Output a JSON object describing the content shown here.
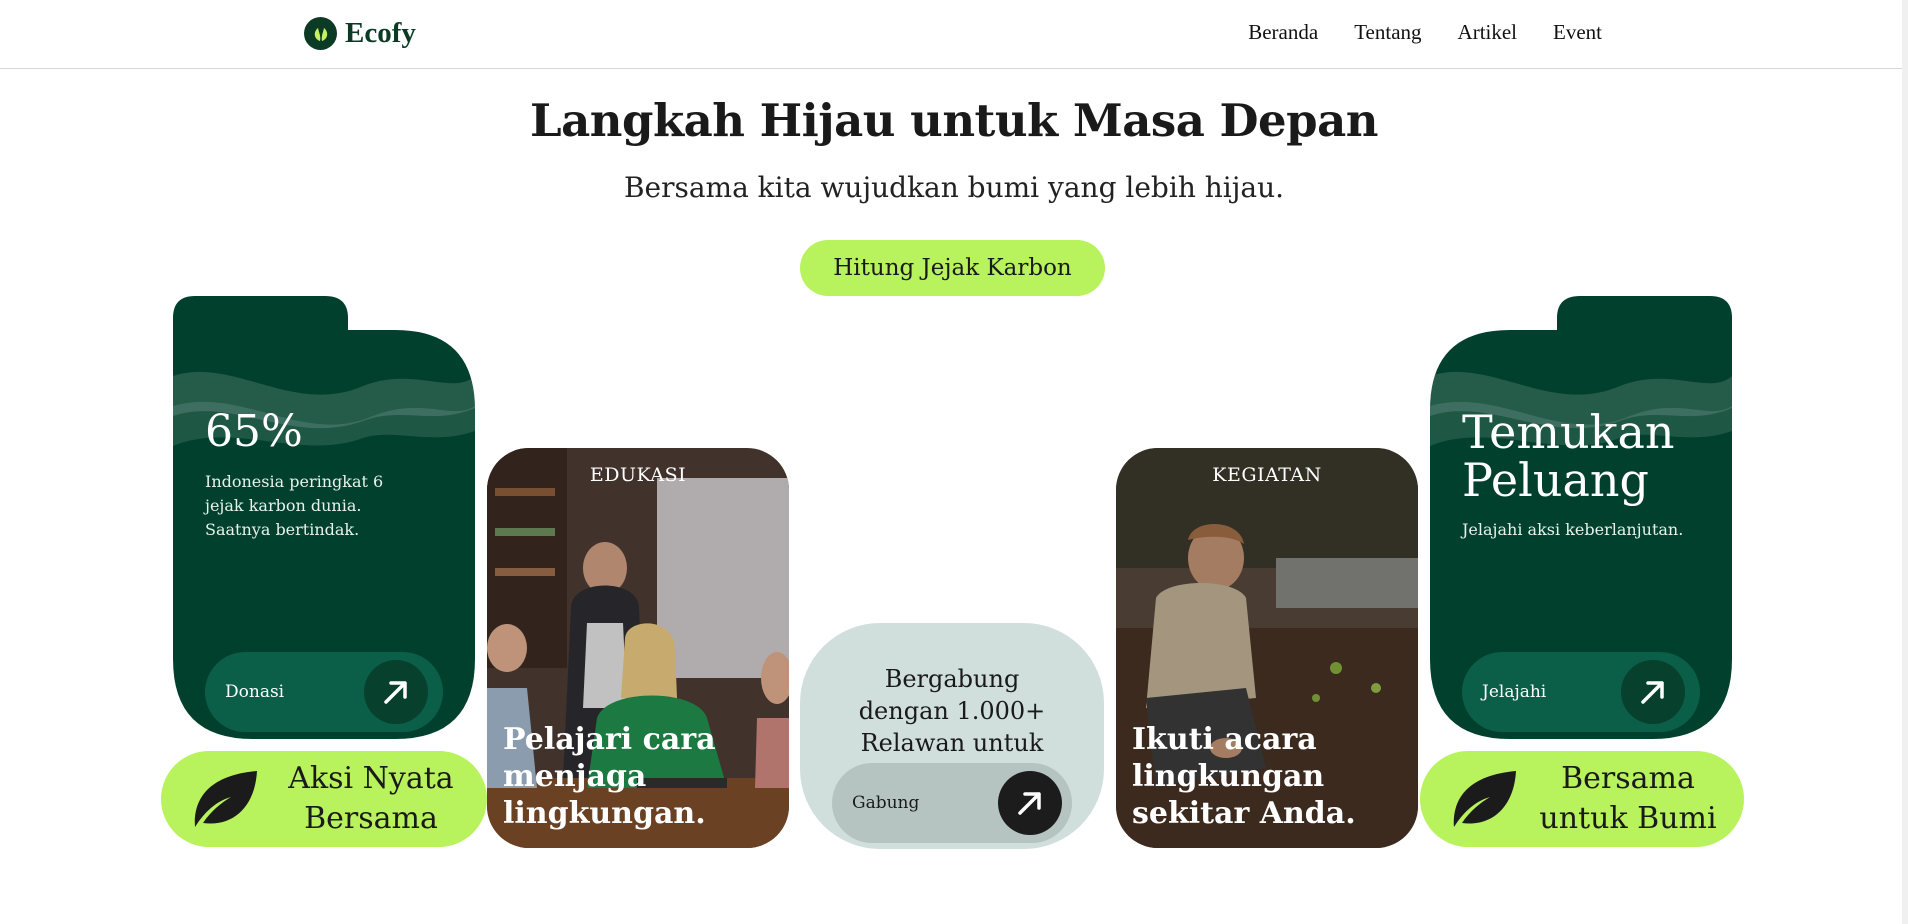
{
  "header": {
    "logo_text": "Ecofy",
    "nav": [
      "Beranda",
      "Tentang",
      "Artikel",
      "Event"
    ]
  },
  "hero": {
    "title": "Langkah Hijau untuk Masa Depan",
    "subtitle": "Bersama kita wujudkan bumi yang lebih hijau.",
    "cta_label": "Hitung Jejak Karbon"
  },
  "card_stat": {
    "value": "65%",
    "description": "Indonesia peringkat 6 jejak karbon dunia. Saatnya bertindak.",
    "button_label": "Donasi"
  },
  "card_opportunity": {
    "title": "Temukan Peluang",
    "description": "Jelajahi aksi keberlanjutan.",
    "button_label": "Jelajahi"
  },
  "badge_left": {
    "text": "Aksi Nyata Bersama",
    "icon": "leaf-icon"
  },
  "badge_right": {
    "text": "Bersama untuk Bumi",
    "icon": "leaf-icon"
  },
  "card_education": {
    "tag": "EDUKASI",
    "caption": "Pelajari cara menjaga lingkungan."
  },
  "card_activity": {
    "tag": "KEGIATAN",
    "caption": "Ikuti acara lingkungan sekitar Anda."
  },
  "card_join": {
    "text": "Bergabung dengan 1.000+ Relawan untuk Perubahan",
    "button_label": "Gabung"
  },
  "colors": {
    "dark_green": "#00402c",
    "lime": "#b8f25c",
    "mint": "#d0dfdb"
  }
}
